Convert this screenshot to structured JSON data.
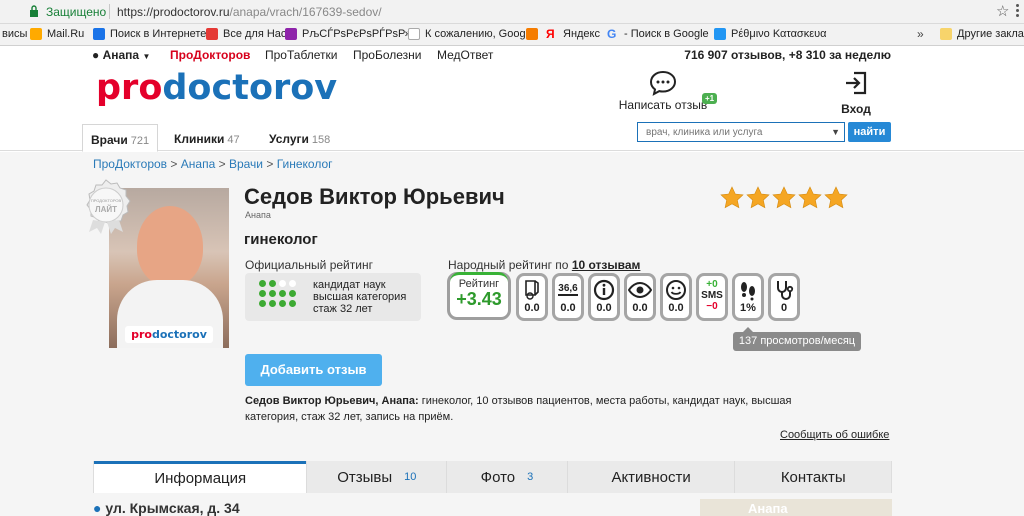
{
  "browser": {
    "secure_label": "Защищено",
    "url_domain": "https://prodoctorov.ru",
    "url_path": "/anapa/vrach/167639-sedov/",
    "bookmarks": [
      {
        "label": "висы",
        "color": "#fff"
      },
      {
        "label": "Mail.Ru",
        "color": "#ffaa00"
      },
      {
        "label": "Поиск в Интернете",
        "color": "#1a73e8"
      },
      {
        "label": "Все для Нас",
        "color": "#e53935"
      },
      {
        "label": "РљСЃРѕРєРѕРЃРѕР»С",
        "color": "#8e24aa"
      },
      {
        "label": "К сожалению, Goog",
        "color": "#ffffff"
      },
      {
        "label": "",
        "color": "#f57c00"
      },
      {
        "label": "Яндекс",
        "color": "#ff0000"
      },
      {
        "label": "- Поиск в Google",
        "color": "#4285f4"
      },
      {
        "label": "Ρέθμινο Κατασκευα",
        "color": "#2196f3"
      }
    ],
    "bookmarks_more": "»",
    "other_bookmarks": "Другие заклад"
  },
  "topbar": {
    "city": "Анапа",
    "links": [
      "ПроДокторов",
      "ПроТаблетки",
      "ПроБолезни",
      "МедОтвет"
    ],
    "stats_reviews": "716 907 отзывов,",
    "stats_week": "+8 310 за неделю"
  },
  "header": {
    "logo_pro": "pro",
    "logo_doc": "doctorov",
    "write_review": "Написать отзыв",
    "write_review_badge": "+1",
    "login": "Вход"
  },
  "search": {
    "tabs": [
      {
        "label": "Врачи",
        "count": "721"
      },
      {
        "label": "Клиники",
        "count": "47"
      },
      {
        "label": "Услуги",
        "count": "158"
      }
    ],
    "placeholder": "врач, клиника или услуга",
    "button": "найти"
  },
  "breadcrumb": [
    "ПроДокторов",
    "Анапа",
    "Врачи",
    "Гинеколог"
  ],
  "breadcrumb_sep": ">",
  "badge": {
    "top": "ПРОДОКТОРОВ",
    "bottom": "ЛАЙТ"
  },
  "doctor": {
    "name": "Седов Виктор Юрьевич",
    "city": "Анапа",
    "specialty": "гинеколог",
    "stars": 5,
    "photo_watermark_pro": "pro",
    "photo_watermark_doc": "doctorov"
  },
  "official_rating": {
    "title": "Официальный рейтинг",
    "dots_filled": 10,
    "dots_total": 12,
    "lines": [
      "кандидат наук",
      "высшая категория",
      "стаж 32 лет"
    ]
  },
  "popular_rating": {
    "title_prefix": "Народный рейтинг по",
    "title_link": "10 отзывам",
    "label": "Рейтинг",
    "value": "+3.43",
    "metrics": [
      {
        "name": "Квалификация",
        "value": "0.0"
      },
      {
        "name": "Внимание",
        "value": "0.0",
        "icon_text": "36,6"
      },
      {
        "name": "Информирование",
        "value": "0.0"
      },
      {
        "name": "Внимание к пациенту",
        "value": "0.0"
      },
      {
        "name": "Общее впечатление",
        "value": "0.0"
      }
    ],
    "sms_plus": "+0",
    "sms_label": "SMS",
    "sms_minus": "−0",
    "steps_value": "1%",
    "steth_value": "0",
    "tooltip": "137 просмотров/месяц"
  },
  "actions": {
    "add_review": "Добавить отзыв",
    "report_error": "Сообщить об ошибке"
  },
  "description": {
    "bold": "Седов Виктор Юрьевич, Анапа:",
    "text": " гинеколог, 10 отзывов пациентов, места работы, кандидат наук, высшая категория, стаж 32 лет, запись на приём."
  },
  "info_tabs": [
    {
      "label": "Информация",
      "count": ""
    },
    {
      "label": "Отзывы",
      "count": "10"
    },
    {
      "label": "Фото",
      "count": "3"
    },
    {
      "label": "Активности",
      "count": ""
    },
    {
      "label": "Контакты",
      "count": ""
    }
  ],
  "address": "ул. Крымская, д. 34",
  "map_label": "Анапа",
  "colors": {
    "brand_red": "#e4002b",
    "brand_blue": "#1b71b8",
    "green": "#3daa33",
    "star": "#f5a623"
  }
}
